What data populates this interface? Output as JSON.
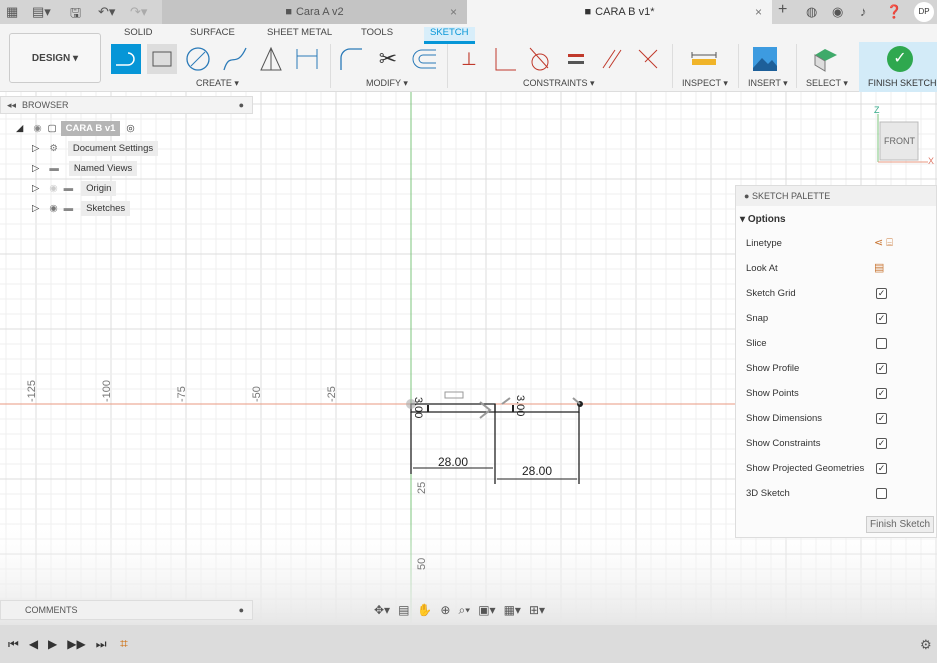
{
  "topbar": {
    "tabs": [
      {
        "label": "Cara A v2",
        "active": false
      },
      {
        "label": "CARA B v1*",
        "active": true
      }
    ],
    "user_initials": "DP"
  },
  "toolbar": {
    "workspace": "DESIGN ▾",
    "tabs": [
      "SOLID",
      "SURFACE",
      "SHEET METAL",
      "TOOLS",
      "SKETCH"
    ],
    "active_tab": "SKETCH",
    "groups": {
      "create": "CREATE ▾",
      "modify": "MODIFY ▾",
      "constraints": "CONSTRAINTS ▾",
      "inspect": "INSPECT ▾",
      "insert": "INSERT ▾",
      "select": "SELECT ▾",
      "finish": "FINISH SKETCH ▾"
    },
    "accent": "#0696d7"
  },
  "browser": {
    "title": "BROWSER",
    "root": "CARA B v1",
    "items": [
      "Document Settings",
      "Named Views",
      "Origin",
      "Sketches"
    ]
  },
  "comments": {
    "title": "COMMENTS"
  },
  "canvas": {
    "x_ticks": [
      "-125",
      "-100",
      "-75",
      "-50",
      "-25"
    ],
    "y_ticks": [
      "25",
      "50"
    ],
    "dimensions": {
      "width_left": "28.00",
      "width_right": "28.00",
      "height_left": "3.00",
      "height_right": "3.00"
    },
    "view_cube": "FRONT",
    "axis_labels": {
      "z": "Z",
      "x": "X"
    }
  },
  "palette": {
    "title": "SKETCH PALETTE",
    "section": "Options",
    "rows": [
      {
        "label": "Linetype",
        "type": "icons"
      },
      {
        "label": "Look At",
        "type": "icon"
      },
      {
        "label": "Sketch Grid",
        "checked": true
      },
      {
        "label": "Snap",
        "checked": true
      },
      {
        "label": "Slice",
        "checked": false
      },
      {
        "label": "Show Profile",
        "checked": true
      },
      {
        "label": "Show Points",
        "checked": true
      },
      {
        "label": "Show Dimensions",
        "checked": true
      },
      {
        "label": "Show Constraints",
        "checked": true
      },
      {
        "label": "Show Projected Geometries",
        "checked": true
      },
      {
        "label": "3D Sketch",
        "checked": false
      }
    ],
    "finish_button": "Finish Sketch"
  }
}
